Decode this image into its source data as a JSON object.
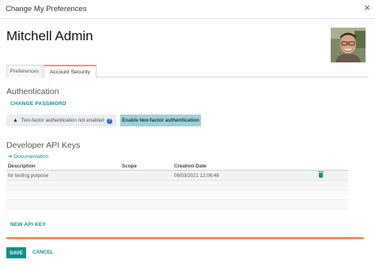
{
  "dialog": {
    "title": "Change My Preferences",
    "close_label": "×"
  },
  "user": {
    "name": "Mitchell Admin"
  },
  "tabs": [
    {
      "label": "Preferences",
      "active": false
    },
    {
      "label": "Account Security",
      "active": true
    }
  ],
  "authentication": {
    "title": "Authentication",
    "change_password_label": "CHANGE PASSWORD",
    "twofa_status": "Two-factor authentication not enabled",
    "help_glyph": "?",
    "enable_twofa_label": "Enable two-factor authentication"
  },
  "api_keys": {
    "title": "Developer API Keys",
    "documentation_label": "Documentation",
    "columns": [
      "Description",
      "Scope",
      "Creation Date"
    ],
    "rows": [
      {
        "description": "for testing purpose",
        "scope": "",
        "creation_date": "06/03/2021 12:06:48"
      }
    ],
    "new_key_label": "NEW API KEY"
  },
  "footer": {
    "save_label": "SAVE",
    "cancel_label": "CANCEL"
  },
  "colors": {
    "accent": "#0e8f87",
    "tab_highlight": "#e59a7c",
    "enable_button": "#9fcfd8"
  }
}
